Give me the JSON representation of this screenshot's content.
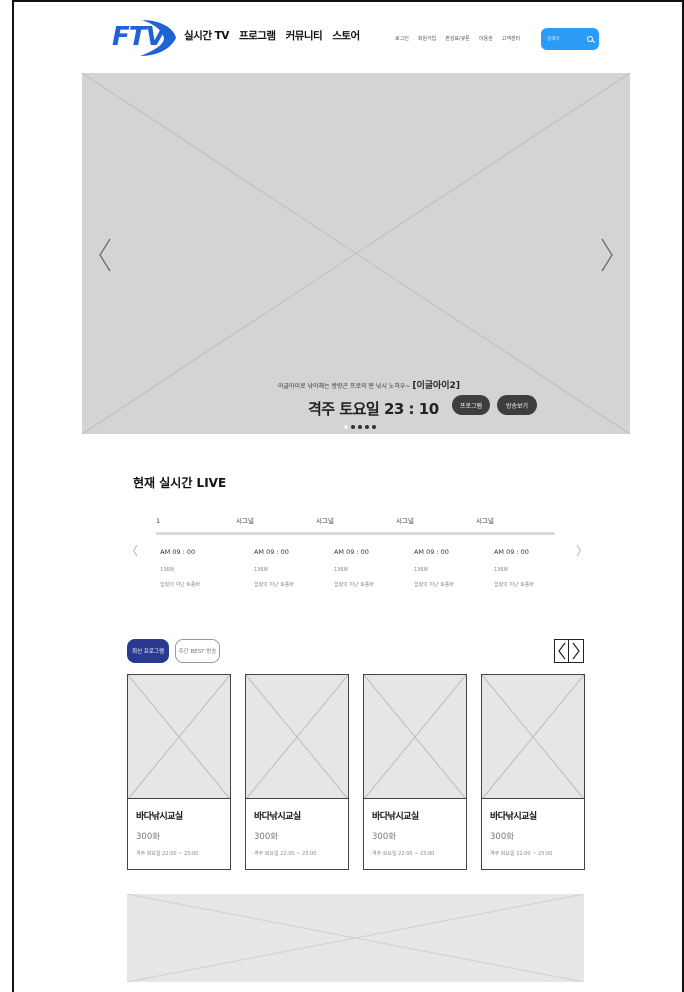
{
  "header": {
    "logo": "FTV",
    "nav": [
      "실시간 TV",
      "프로그램",
      "커뮤니티",
      "스토어"
    ],
    "util": [
      "로그인",
      "회원가입",
      "편성표/큐톤",
      "이용권",
      "고객센터"
    ],
    "search_placeholder": "검색어"
  },
  "hero": {
    "caption": "이글아이로 낚아채는 방랑곤 프로의 찐 낚시 노하우~",
    "caption_title": "[이글아이2]",
    "schedule": "격주 토요일 23 : 10",
    "btn_program": "프로그램",
    "btn_watch": "방송보기",
    "slide_count": 5,
    "active_slide": 0
  },
  "live": {
    "title": "현재 실시간 LIVE",
    "prev": "〈",
    "next": "〉",
    "channels": [
      {
        "name": "1",
        "time": "AM 09 : 00",
        "episode": "136화",
        "desc": "입질의 지난 토종바"
      },
      {
        "name": "시그널",
        "time": "AM 09 : 00",
        "episode": "136화",
        "desc": "입질의 지난 토종바"
      },
      {
        "name": "시그널",
        "time": "AM 09 : 00",
        "episode": "136화",
        "desc": "입질의 지난 토종바"
      },
      {
        "name": "시그널",
        "time": "AM 09 : 00",
        "episode": "136화",
        "desc": "입질의 지난 토종바"
      },
      {
        "name": "시그널",
        "time": "AM 09 : 00",
        "episode": "136화",
        "desc": "입질의 지난 토종바"
      }
    ]
  },
  "programs": {
    "tab_latest": "최신 프로그램",
    "tab_best": "주간 BEST 방송",
    "cards": [
      {
        "title": "바다낚시교실",
        "episode": "300화",
        "schedule": "격주 화요일 22:00 ~ 23:00"
      },
      {
        "title": "바다낚시교실",
        "episode": "300화",
        "schedule": "격주 화요일 22:00 ~ 23:00"
      },
      {
        "title": "바다낚시교실",
        "episode": "300화",
        "schedule": "격주 화요일 22:00 ~ 23:00"
      },
      {
        "title": "바다낚시교실",
        "episode": "300화",
        "schedule": "격주 화요일 22:00 ~ 23:00"
      }
    ]
  },
  "colors": {
    "brand": "#1c63d6",
    "search_bg": "#2b9cf6",
    "tab_active": "#2a3b8f",
    "placeholder": "#d4d4d4"
  }
}
